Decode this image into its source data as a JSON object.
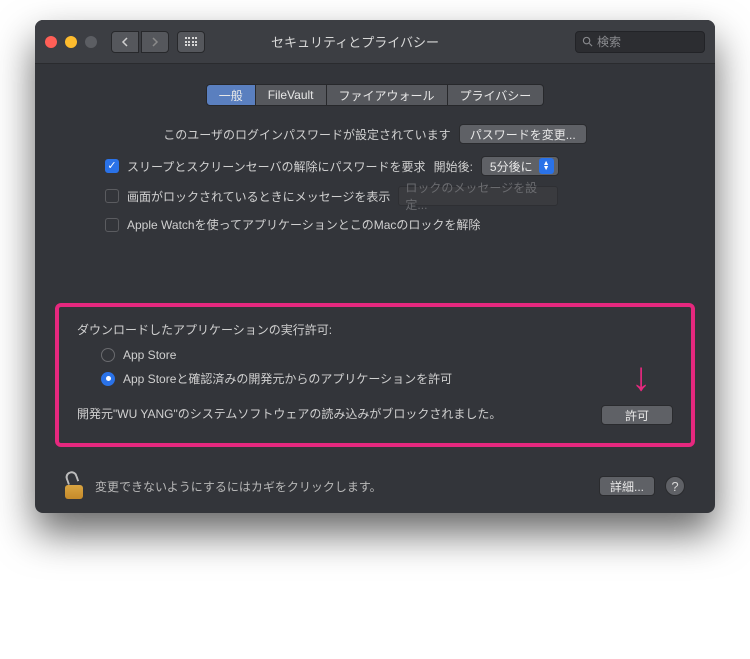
{
  "window": {
    "title": "セキュリティとプライバシー",
    "search_placeholder": "検索"
  },
  "tabs": [
    "一般",
    "FileVault",
    "ファイアウォール",
    "プライバシー"
  ],
  "password_section": {
    "description": "このユーザのログインパスワードが設定されています",
    "change_button": "パスワードを変更...",
    "require_password_label": "スリープとスクリーンセーバの解除にパスワードを要求",
    "after_label": "開始後:",
    "delay_value": "5分後に",
    "lock_message_label": "画面がロックされているときにメッセージを表示",
    "lock_message_placeholder": "ロックのメッセージを設定...",
    "apple_watch_label": "Apple Watchを使ってアプリケーションとこのMacのロックを解除"
  },
  "download_section": {
    "title": "ダウンロードしたアプリケーションの実行許可:",
    "option_appstore": "App Store",
    "option_identified": "App Storeと確認済みの開発元からのアプリケーションを許可",
    "blocked_message": "開発元\"WU YANG\"のシステムソフトウェアの読み込みがブロックされました。",
    "allow_button": "許可"
  },
  "footer": {
    "lock_text": "変更できないようにするにはカギをクリックします。",
    "details_button": "詳細...",
    "help": "?"
  }
}
